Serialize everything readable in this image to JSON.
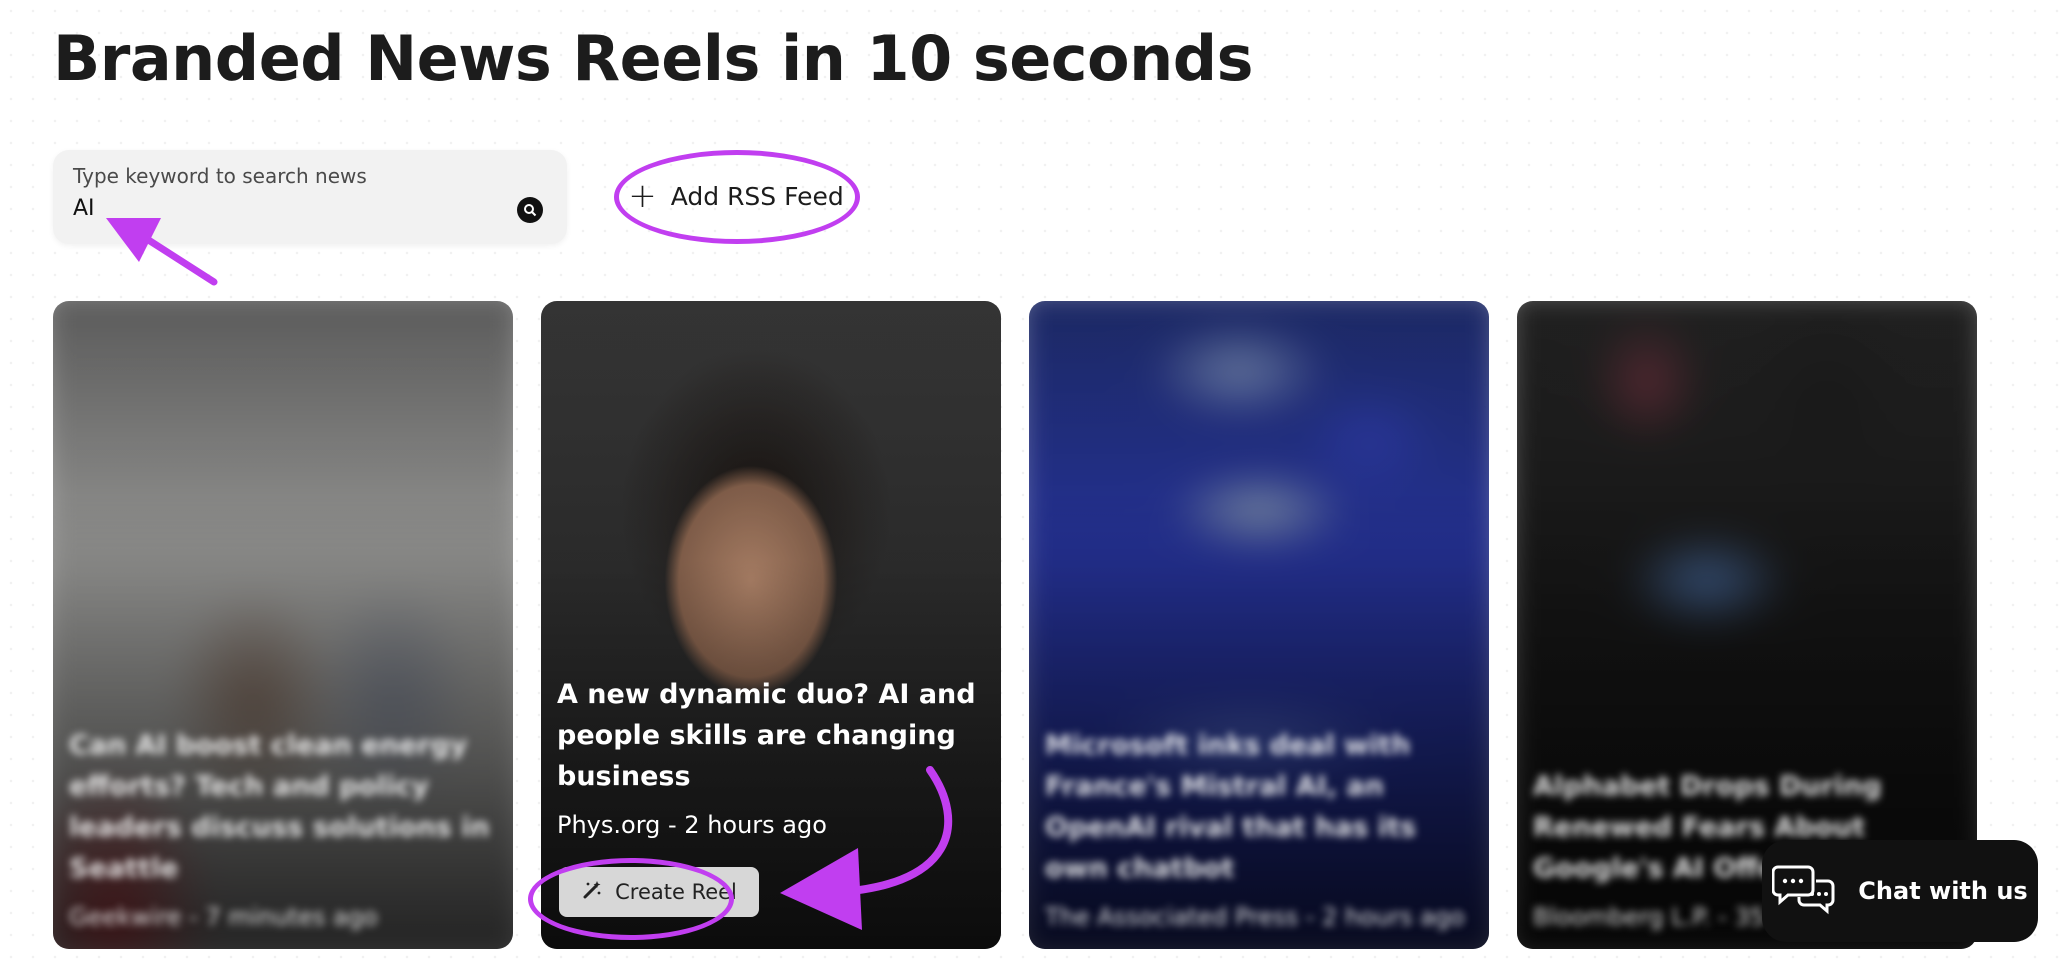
{
  "page": {
    "title": "Branded News Reels in 10 seconds"
  },
  "search": {
    "label": "Type keyword to search news",
    "value": "AI"
  },
  "rss": {
    "label": "Add RSS Feed"
  },
  "cards": [
    {
      "title": "Can AI boost clean energy efforts? Tech and policy leaders discuss solutions in Seattle",
      "meta": "Geekwire - 7 minutes ago",
      "blurred": true
    },
    {
      "title": "A new dynamic duo? AI and people skills are changing business",
      "meta": "Phys.org - 2 hours ago",
      "button": "Create Reel",
      "blurred": false
    },
    {
      "title": "Microsoft inks deal with France's Mistral AI, an OpenAI rival that has its own chatbot",
      "meta": "The Associated Press - 2 hours ago",
      "blurred": true
    },
    {
      "title": "Alphabet Drops During Renewed Fears About Google's AI Offer",
      "meta": "Bloomberg L.P. - 35",
      "blurred": true
    }
  ],
  "chat": {
    "label": "Chat with us"
  },
  "colors": {
    "annotation": "#c13ef0",
    "accent": "#111111"
  }
}
